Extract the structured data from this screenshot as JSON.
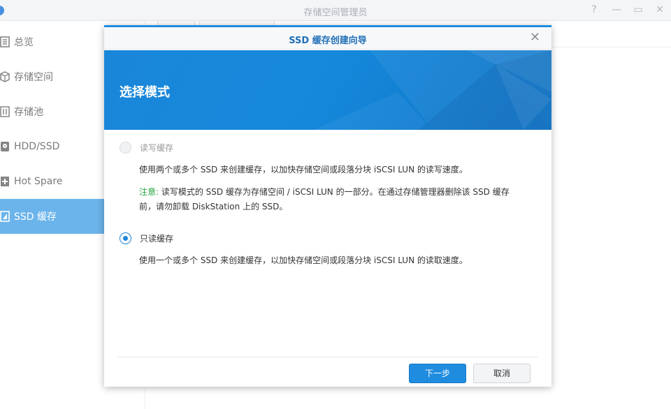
{
  "window": {
    "title": "存储空间管理员",
    "controls": [
      "pin-icon",
      "minimize-icon",
      "maximize-icon",
      "close-icon"
    ]
  },
  "sidebar": {
    "items": [
      {
        "label": "总览",
        "icon": "overview-icon"
      },
      {
        "label": "存储空间",
        "icon": "volume-icon"
      },
      {
        "label": "存储池",
        "icon": "storage-pool-icon"
      },
      {
        "label": "HDD/SSD",
        "icon": "disk-icon"
      },
      {
        "label": "Hot Spare",
        "icon": "hot-spare-icon"
      },
      {
        "label": "SSD 缓存",
        "icon": "ssd-cache-icon",
        "active": true
      }
    ]
  },
  "dialog": {
    "title": "SSD 缓存创建向导",
    "banner_title": "选择模式",
    "options": [
      {
        "label": "读写缓存",
        "disabled": true,
        "checked": false,
        "description": "使用两个或多个 SSD 来创建缓存，以加快存储空间或段落分块 iSCSI LUN 的读写速度。",
        "note_label": "注意:",
        "note_line1": " 读写模式的 SSD 缓存为存储空间 / iSCSI LUN 的一部分。在通过存储管理器删除该 SSD 缓存",
        "note_line2": "前，请勿卸载 DiskStation 上的 SSD。"
      },
      {
        "label": "只读缓存",
        "disabled": false,
        "checked": true,
        "description": "使用一个或多个 SSD 来创建缓存，以加快存储空间或段落分块 iSCSI LUN 的读取速度。"
      }
    ],
    "buttons": {
      "next": "下一步",
      "cancel": "取消"
    }
  },
  "colors": {
    "accent": "#1f8ce0",
    "note": "#28a745"
  }
}
